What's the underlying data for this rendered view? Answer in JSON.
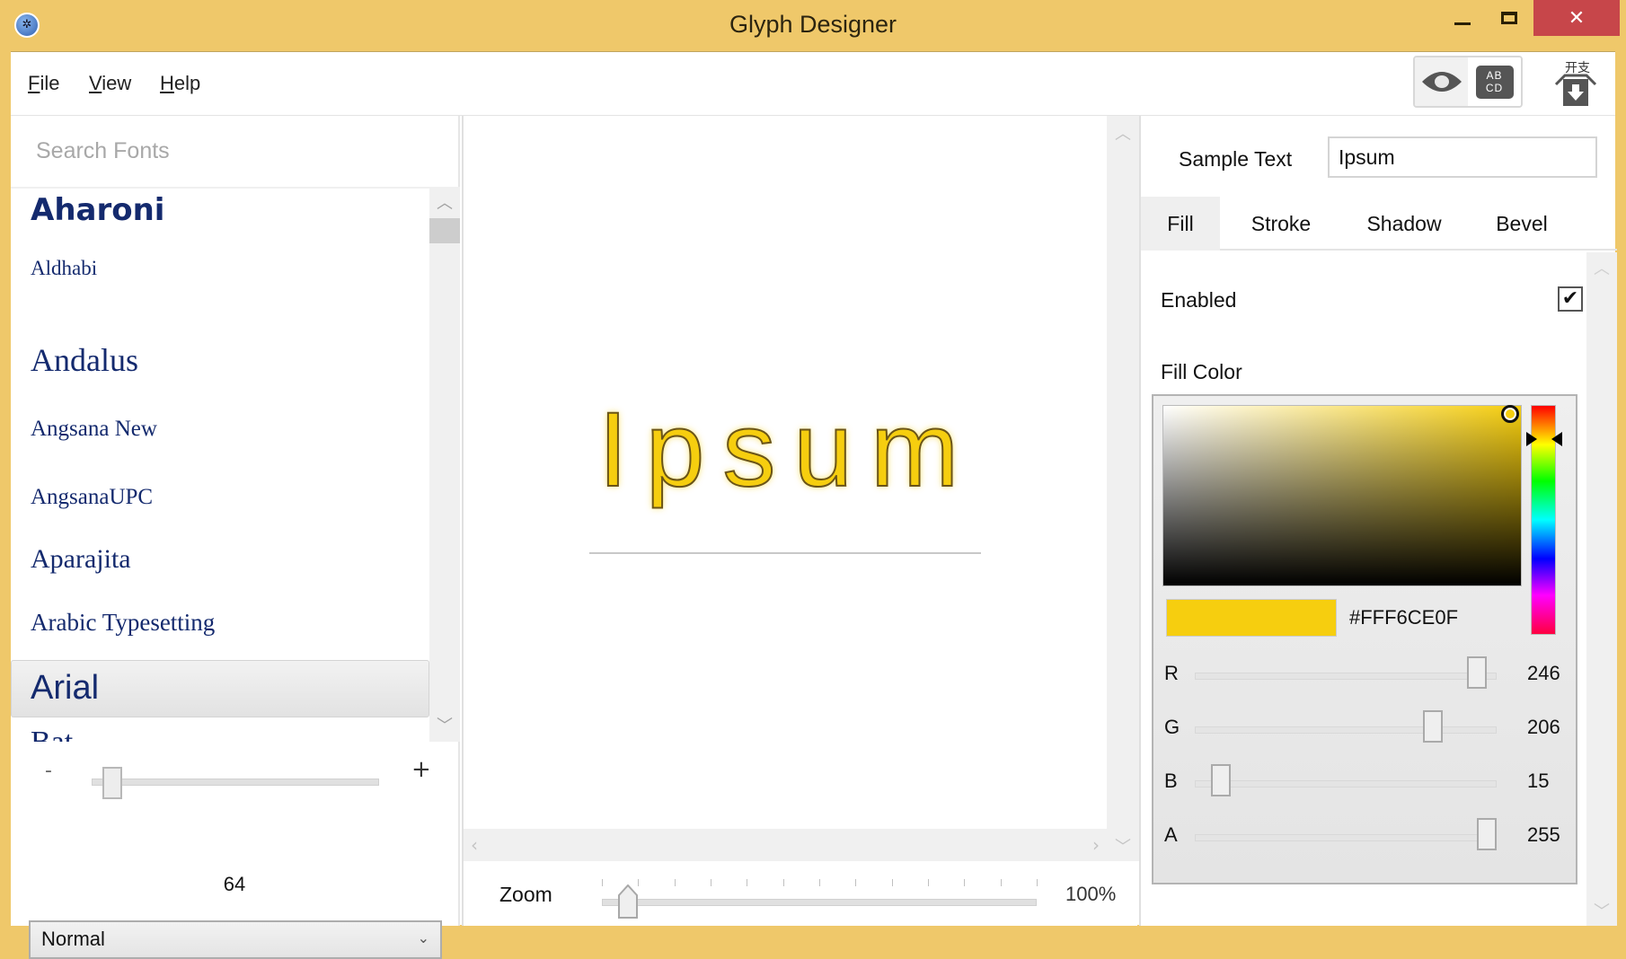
{
  "window": {
    "title": "Glyph Designer",
    "controls": {
      "minimize": "minimize",
      "maximize": "maximize",
      "close": "✕"
    }
  },
  "menu": {
    "items": [
      {
        "label": "File",
        "mnemonic": "F",
        "rest": "ile"
      },
      {
        "label": "View",
        "mnemonic": "V",
        "rest": "iew"
      },
      {
        "label": "Help",
        "mnemonic": "H",
        "rest": "elp"
      }
    ]
  },
  "toolbar": {
    "preview_toggle_icon": "eye-icon",
    "charset_toggle_icon": "abcd-icon",
    "charset_label_line1": "AB",
    "charset_label_line2": "CD",
    "export_icon": "export-box-icon"
  },
  "font_panel": {
    "search_placeholder": "Search Fonts",
    "fonts": [
      {
        "name": "Aharoni",
        "selected": false
      },
      {
        "name": "Aldhabi",
        "selected": false
      },
      {
        "name": "Andalus",
        "selected": false
      },
      {
        "name": "Angsana New",
        "selected": false
      },
      {
        "name": "AngsanaUPC",
        "selected": false
      },
      {
        "name": "Aparajita",
        "selected": false
      },
      {
        "name": "Arabic Typesetting",
        "selected": false
      },
      {
        "name": "Arial",
        "selected": true
      },
      {
        "name": "Bat...",
        "selected": false
      }
    ],
    "size": {
      "minus": "-",
      "plus": "+",
      "value": "64",
      "fraction": 0.04
    },
    "style_select": {
      "value": "Normal",
      "chevron": "⌄"
    }
  },
  "canvas": {
    "preview_text": "Ipsum",
    "zoom": {
      "label": "Zoom",
      "value": "100%",
      "fraction": 0.04,
      "tick_count": 13
    }
  },
  "properties": {
    "sample_text_label": "Sample Text",
    "sample_text_value": "Ipsum",
    "tabs": [
      {
        "label": "Fill",
        "active": true
      },
      {
        "label": "Stroke",
        "active": false
      },
      {
        "label": "Shadow",
        "active": false
      },
      {
        "label": "Bevel",
        "active": false
      }
    ],
    "fill": {
      "enabled_label": "Enabled",
      "enabled": true,
      "check_glyph": "✔",
      "fill_color_label": "Fill Color",
      "hex": "#FFF6CE0F",
      "swatch_color": "#f6ce0f",
      "hue_fraction": 0.15,
      "channels": [
        {
          "label": "R",
          "value": 246,
          "max": 255
        },
        {
          "label": "G",
          "value": 206,
          "max": 255
        },
        {
          "label": "B",
          "value": 15,
          "max": 255
        },
        {
          "label": "A",
          "value": 255,
          "max": 255
        }
      ]
    }
  }
}
